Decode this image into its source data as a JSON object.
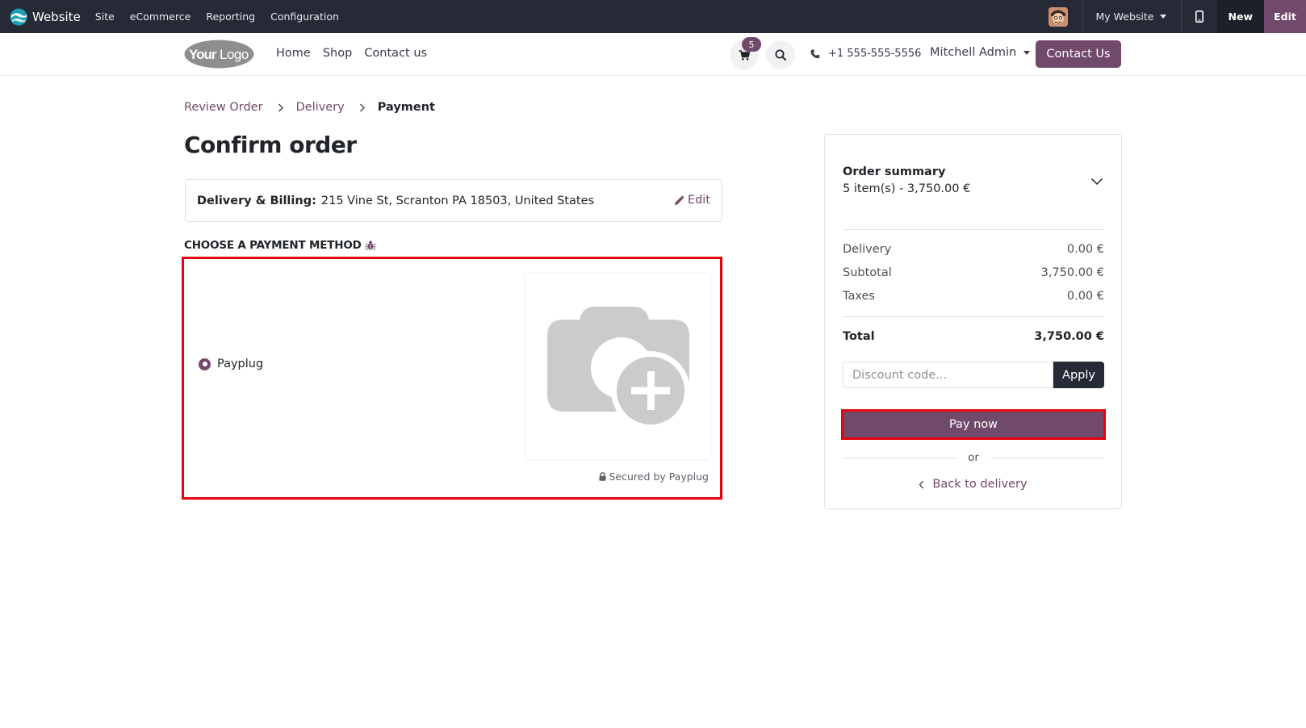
{
  "admin_bar": {
    "brand": "Website",
    "menu": [
      "Site",
      "eCommerce",
      "Reporting",
      "Configuration"
    ],
    "site_switcher": "My Website",
    "new_label": "New",
    "edit_label": "Edit"
  },
  "header": {
    "nav": [
      "Home",
      "Shop",
      "Contact us"
    ],
    "cart_count": "5",
    "phone": "+1 555-555-5556",
    "user": "Mitchell Admin",
    "contact_button": "Contact Us"
  },
  "breadcrumb": {
    "items": [
      "Review Order",
      "Delivery"
    ],
    "active": "Payment"
  },
  "page_title": "Confirm order",
  "address": {
    "label": "Delivery & Billing:",
    "value": "215 Vine St, Scranton PA 18503, United States",
    "edit_label": "Edit"
  },
  "payment": {
    "heading": "CHOOSE A PAYMENT METHOD",
    "option_label": "Payplug",
    "secured_label": "Secured by Payplug"
  },
  "summary": {
    "title": "Order summary",
    "items": "5 item(s) -  3,750.00 €",
    "delivery_label": "Delivery",
    "delivery_value": "0.00 €",
    "subtotal_label": "Subtotal",
    "subtotal_value": "3,750.00 €",
    "taxes_label": "Taxes",
    "taxes_value": "0.00 €",
    "total_label": "Total",
    "total_value": "3,750.00 €",
    "discount_placeholder": "Discount code...",
    "apply_label": "Apply",
    "pay_now_label": "Pay now",
    "or_label": "or",
    "back_label": "Back to delivery"
  },
  "colors": {
    "brand": "#71496a",
    "admin_bar": "#262a36",
    "highlight": "#e8000f"
  }
}
